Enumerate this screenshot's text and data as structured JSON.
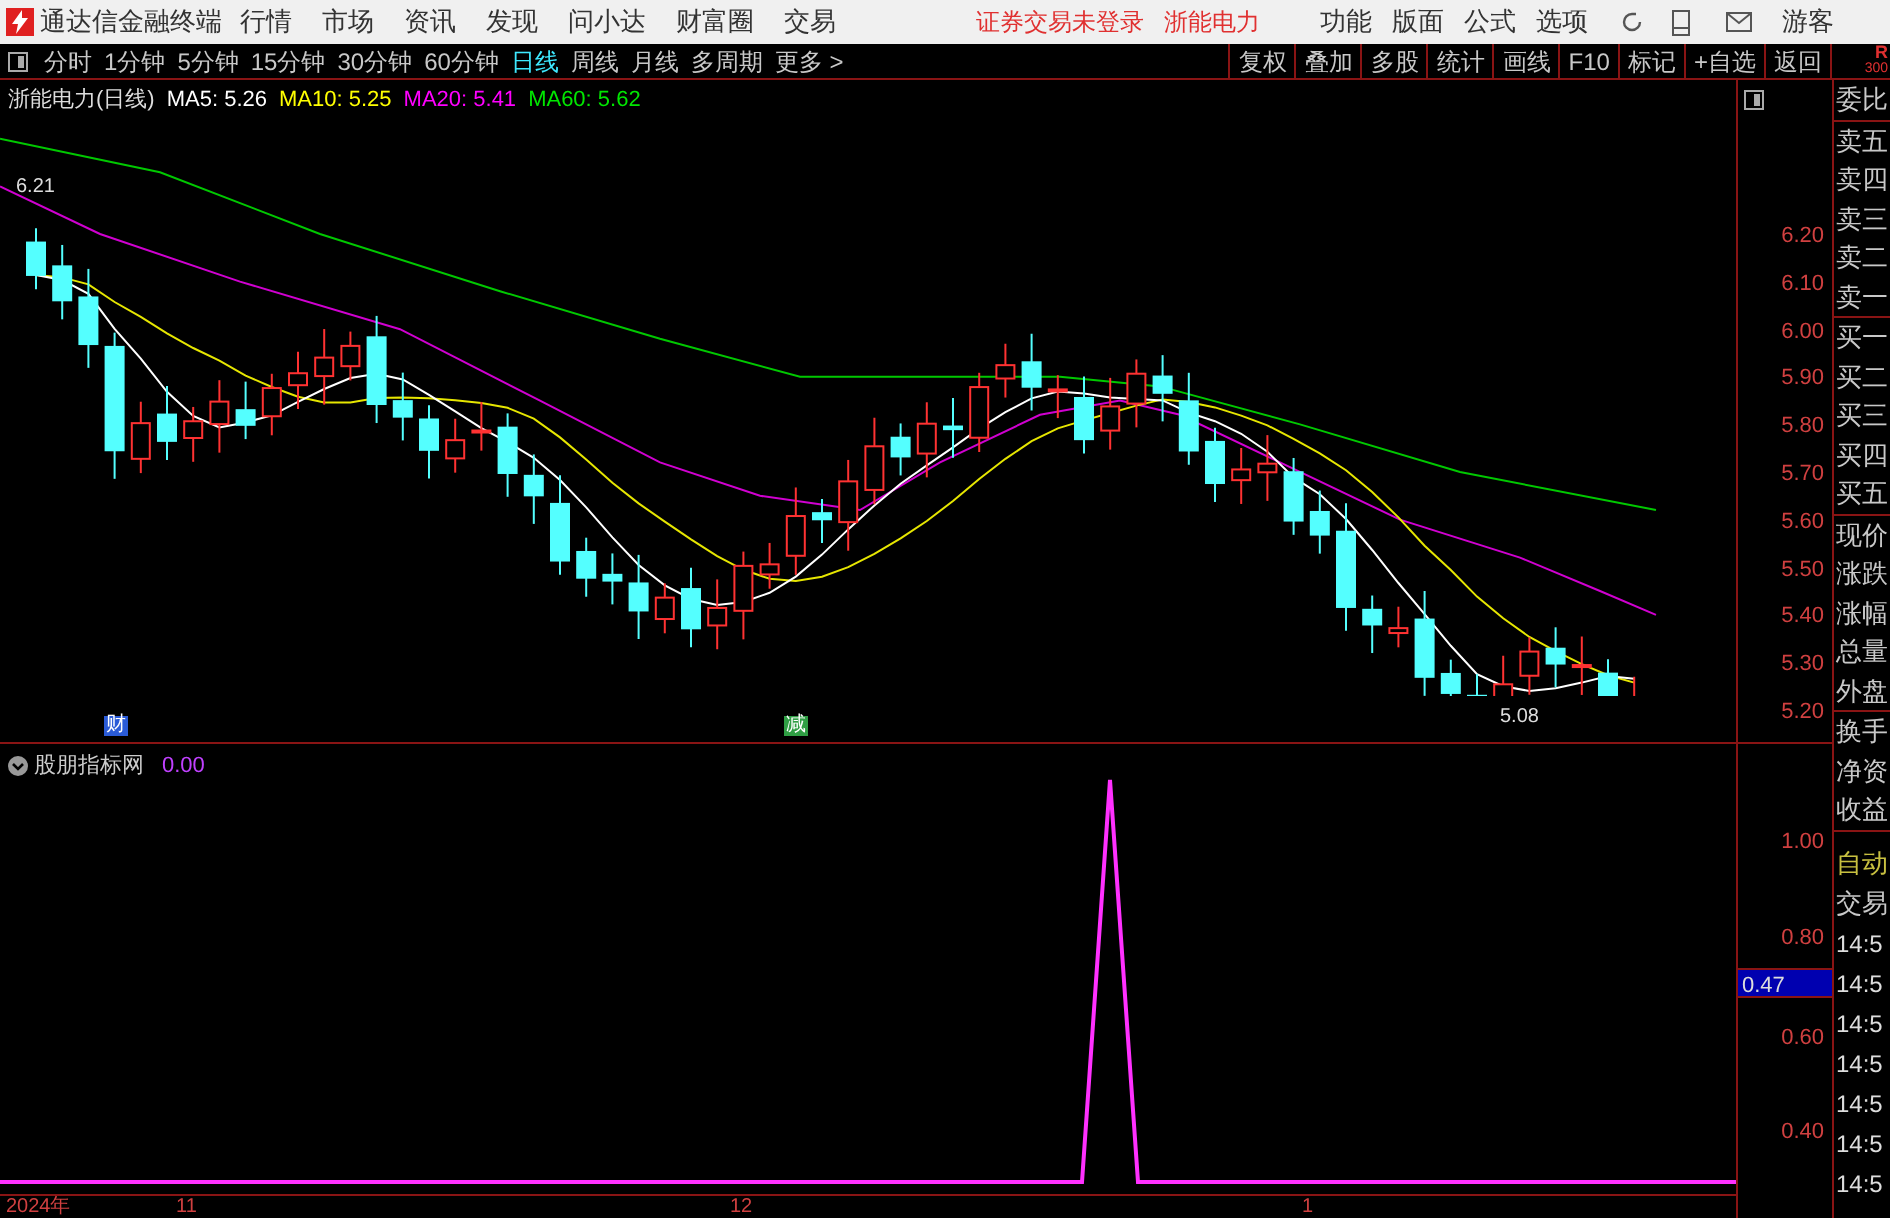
{
  "title_bar": {
    "app_name": "通达信金融终端",
    "menus": [
      "行情",
      "市场",
      "资讯",
      "发现",
      "问小达",
      "财富圈",
      "交易"
    ],
    "notices": [
      "证券交易未登录",
      "浙能电力"
    ],
    "tools": [
      "功能",
      "版面",
      "公式",
      "选项"
    ],
    "user": "游客"
  },
  "period_tabs": [
    {
      "label": "分时",
      "selected": false
    },
    {
      "label": "1分钟",
      "selected": false
    },
    {
      "label": "5分钟",
      "selected": false
    },
    {
      "label": "15分钟",
      "selected": false
    },
    {
      "label": "30分钟",
      "selected": false
    },
    {
      "label": "60分钟",
      "selected": false
    },
    {
      "label": "日线",
      "selected": true
    },
    {
      "label": "周线",
      "selected": false
    },
    {
      "label": "月线",
      "selected": false
    },
    {
      "label": "多周期",
      "selected": false
    },
    {
      "label": "更多 >",
      "selected": false
    }
  ],
  "toolbar_buttons": [
    "复权",
    "叠加",
    "多股",
    "统计",
    "画线",
    "F10",
    "标记",
    "+自选",
    "返回"
  ],
  "corner": [
    "R",
    "300"
  ],
  "price_chart": {
    "stock": "浙能电力(日线)",
    "ma": [
      {
        "name": "MA5:",
        "value": "5.26",
        "color": "#ffffff"
      },
      {
        "name": "MA10:",
        "value": "5.25",
        "color": "#ffff00"
      },
      {
        "name": "MA20:",
        "value": "5.41",
        "color": "#ff00ff"
      },
      {
        "name": "MA60:",
        "value": "5.62",
        "color": "#00e600"
      }
    ],
    "yticks": [
      "6.20",
      "6.10",
      "6.00",
      "5.90",
      "5.80",
      "5.70",
      "5.60",
      "5.50",
      "5.40",
      "5.30",
      "5.20"
    ],
    "high_label": "6.21",
    "low_label": "5.08",
    "event_marks": [
      {
        "label": "财",
        "color": "#2a5bd7"
      },
      {
        "label": "减",
        "color": "#2f9e44"
      }
    ]
  },
  "indicator": {
    "name": "股朋指标网",
    "value": "0.00",
    "yticks": [
      "1.00",
      "0.80",
      "0.60",
      "0.40"
    ],
    "cursor_value": "0.47"
  },
  "date_axis": [
    "2024年",
    "11",
    "12",
    "1"
  ],
  "quote_panel": {
    "groups": [
      {
        "labels": [
          "委比"
        ]
      },
      {
        "labels": [
          "卖五",
          "卖四",
          "卖三",
          "卖二",
          "卖一"
        ]
      },
      {
        "labels": [
          "买一",
          "买二",
          "买三",
          "买四",
          "买五"
        ]
      },
      {
        "labels": [
          "现价",
          "涨跌",
          "涨幅",
          "总量",
          "外盘"
        ]
      },
      {
        "labels": [
          "换手",
          "净资",
          "收益"
        ]
      }
    ],
    "trade_labels": [
      "自动",
      "交易"
    ],
    "times": [
      "14:5",
      "14:5",
      "14:5",
      "14:5",
      "14:5",
      "14:5",
      "14:5"
    ]
  }
}
